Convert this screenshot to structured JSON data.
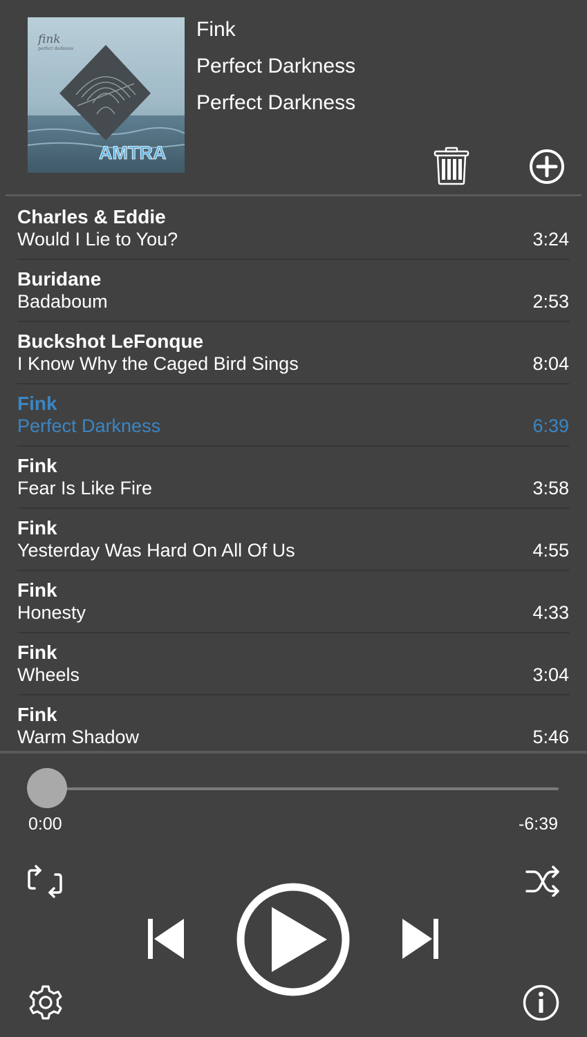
{
  "now_playing": {
    "artist": "Fink",
    "title": "Perfect Darkness",
    "album": "Perfect Darkness",
    "album_art": {
      "band_mark": "fink",
      "caption": "perfect darkness",
      "watermark": "AMTRA"
    }
  },
  "header_actions": {
    "delete_icon": "trash-icon",
    "add_icon": "plus-circle-icon"
  },
  "tracks": [
    {
      "artist": "Charles & Eddie",
      "title": "Would I Lie to You?",
      "duration": "3:24",
      "active": false
    },
    {
      "artist": "Buridane",
      "title": "Badaboum",
      "duration": "2:53",
      "active": false
    },
    {
      "artist": "Buckshot LeFonque",
      "title": "I Know Why the Caged Bird Sings",
      "duration": "8:04",
      "active": false
    },
    {
      "artist": "Fink",
      "title": "Perfect Darkness",
      "duration": "6:39",
      "active": true
    },
    {
      "artist": "Fink",
      "title": "Fear Is Like Fire",
      "duration": "3:58",
      "active": false
    },
    {
      "artist": "Fink",
      "title": "Yesterday Was Hard On All Of Us",
      "duration": "4:55",
      "active": false
    },
    {
      "artist": "Fink",
      "title": "Honesty",
      "duration": "4:33",
      "active": false
    },
    {
      "artist": "Fink",
      "title": "Wheels",
      "duration": "3:04",
      "active": false
    },
    {
      "artist": "Fink",
      "title": "Warm Shadow",
      "duration": "5:46",
      "active": false
    }
  ],
  "playback": {
    "elapsed": "0:00",
    "remaining": "-6:39",
    "progress": 0
  },
  "controls": {
    "repeat_icon": "repeat-icon",
    "shuffle_icon": "shuffle-icon",
    "previous_icon": "skip-back-icon",
    "play_icon": "play-circle-icon",
    "next_icon": "skip-forward-icon",
    "settings_icon": "gear-icon",
    "info_icon": "info-icon"
  },
  "colors": {
    "background": "#414141",
    "accent": "#3a86c4",
    "text": "#ffffff"
  }
}
